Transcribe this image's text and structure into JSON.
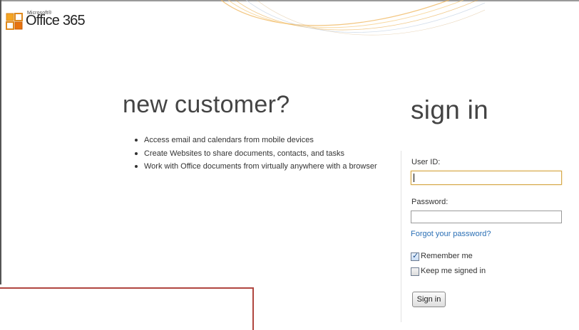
{
  "header": {
    "logo_brand": "Microsoft®",
    "logo_product": "Office 365",
    "logo_icon": "office-logo-icon"
  },
  "new_customer": {
    "title": "new customer?",
    "features": [
      "Access email and calendars from mobile devices",
      "Create Websites to share documents, contacts, and tasks",
      "Work with Office documents from virtually anywhere with a browser"
    ]
  },
  "signin": {
    "title": "sign in",
    "userid_label": "User ID:",
    "userid_value": "",
    "password_label": "Password:",
    "password_value": "",
    "forgot_link": "Forgot your password?",
    "remember_label": "Remember me",
    "remember_checked": true,
    "keep_label": "Keep me signed in",
    "keep_checked": false,
    "button_label": "Sign in"
  },
  "colors": {
    "focus_border": "#d6a94a",
    "link": "#2a6fb5",
    "annotation_box": "#b0463f"
  }
}
